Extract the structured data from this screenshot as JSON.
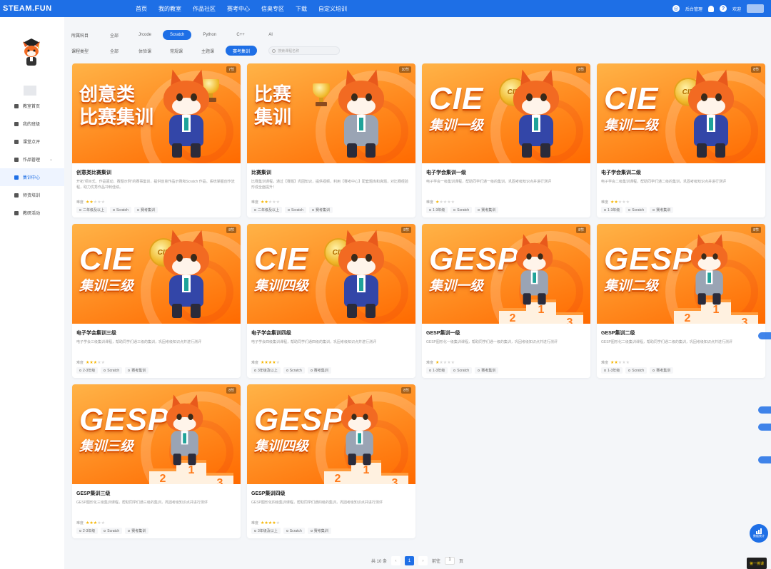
{
  "topbar": {
    "logo": "STEAM.FUN",
    "nav": [
      "首页",
      "我的教室",
      "作品社区",
      "赛考中心",
      "信奥专区",
      "下载",
      "自定义培训"
    ],
    "admin_label": "后台管理",
    "user_label": "欢迎"
  },
  "sidebar": {
    "items": [
      {
        "label": "教室首页",
        "icon": "home-icon"
      },
      {
        "label": "我的班级",
        "icon": "user-icon"
      },
      {
        "label": "课堂点评",
        "icon": "star-icon"
      },
      {
        "label": "作品管理",
        "icon": "folder-icon"
      },
      {
        "label": "集训中心",
        "icon": "book-icon"
      },
      {
        "label": "师资培训",
        "icon": "video-icon"
      },
      {
        "label": "教研活动",
        "icon": "monitor-icon"
      }
    ],
    "active_index": 4
  },
  "filters": {
    "subject_label": "所属科目",
    "subjects": [
      "全部",
      "Jrcode",
      "Scratch",
      "Python",
      "C++",
      "AI"
    ],
    "subject_active": 2,
    "type_label": "课程类型",
    "types": [
      "全部",
      "体验课",
      "常规课",
      "主题课",
      "赛考集训"
    ],
    "type_active": 4,
    "search_placeholder": "搜索课程名称"
  },
  "courses": [
    {
      "title": "创意类比赛集训",
      "desc": "开拓“项目式、作品驱动、赛题示例”的赛事集训，提供创意作品示例和Scratch 作品。系统掌握创作流程，助力优秀作品冲刺佳绩。",
      "level": 2,
      "grade": "二年级及以上",
      "lang": "Scratch",
      "type": "赛考集训",
      "badge": "7节",
      "banner_l1": "创意类",
      "banner_l2": "比赛集训"
    },
    {
      "title": "比赛集训",
      "desc": "比赛集训课程，通过【赛题】巩固知识，提供视频，利用【赛考中心】配套题库和真题，对比赛经验形成全面提升！",
      "level": 2,
      "grade": "二年级及以上",
      "lang": "Scratch",
      "type": "赛考集训",
      "badge": "10节",
      "banner_l1": "比赛",
      "banner_l2": "集训"
    },
    {
      "title": "电子学会集训一级",
      "desc": "电子学会一级集训课程，帮助同学们通一级的集训，巩固考级知识点并进行测评",
      "level": 1,
      "grade": "1-3年级",
      "lang": "Scratch",
      "type": "赛考集训",
      "badge": "8节",
      "banner_l1": "CIE",
      "banner_l2": "集训一级"
    },
    {
      "title": "电子学会集训二级",
      "desc": "电子学会二级集训课程，帮助同学们通二级的集训，巩固考级知识点并进行测评",
      "level": 2,
      "grade": "1-3年级",
      "lang": "Scratch",
      "type": "赛考集训",
      "badge": "8节",
      "banner_l1": "CIE",
      "banner_l2": "集训二级"
    },
    {
      "title": "电子学会集训三级",
      "desc": "电子学会三级集训课程，帮助同学们通三级的集训，巩固考级知识点并进行测评",
      "level": 3,
      "grade": "2-3年级",
      "lang": "Scratch",
      "type": "赛考集训",
      "badge": "8节",
      "banner_l1": "CIE",
      "banner_l2": "集训三级"
    },
    {
      "title": "电子学会集训四级",
      "desc": "电子学会四级集训课程，帮助同学们通四级的集训，巩固考级知识点并进行测评",
      "level": 4,
      "grade": "3年级及以上",
      "lang": "Scratch",
      "type": "赛考集训",
      "badge": "8节",
      "banner_l1": "CIE",
      "banner_l2": "集训四级"
    },
    {
      "title": "GESP集训一级",
      "desc": "GESP图形化一级集训课程，帮助同学们通一级的集训，巩固考级知识点并进行测评",
      "level": 1,
      "grade": "1-3年级",
      "lang": "Scratch",
      "type": "赛考集训",
      "badge": "8节",
      "banner_l1": "GESP",
      "banner_l2": "集训一级"
    },
    {
      "title": "GESP集训二级",
      "desc": "GESP图形化二级集训课程，帮助同学们通二级的集训，巩固考级知识点并进行测评",
      "level": 2,
      "grade": "1-3年级",
      "lang": "Scratch",
      "type": "赛考集训",
      "badge": "8节",
      "banner_l1": "GESP",
      "banner_l2": "集训二级"
    },
    {
      "title": "GESP集训三级",
      "desc": "GESP图形化三级集训课程，帮助同学们通三级的集训，巩固考级知识点并进行测评",
      "level": 3,
      "grade": "2-3年级",
      "lang": "Scratch",
      "type": "赛考集训",
      "badge": "8节",
      "banner_l1": "GESP",
      "banner_l2": "集训三级"
    },
    {
      "title": "GESP集训四级",
      "desc": "GESP图形化四级集训课程，帮助同学们通四级的集训，巩固考级知识点并进行测评",
      "level": 4,
      "grade": "3年级及以上",
      "lang": "Scratch",
      "type": "赛考集训",
      "badge": "8节",
      "banner_l1": "GESP",
      "banner_l2": "集训四级"
    }
  ],
  "difficulty_label": "难度",
  "pagination": {
    "total": "共 10 条",
    "current": "1",
    "prev": "‹",
    "next": "›",
    "goto_label": "前往",
    "goto_value": "1",
    "page_unit": "页"
  },
  "float": {
    "stats_label": "数据统计",
    "corner_label": "第一排课"
  },
  "colors": {
    "primary": "#1e6fe6",
    "banner": "#ff8a1f",
    "star": "#f5b400"
  }
}
